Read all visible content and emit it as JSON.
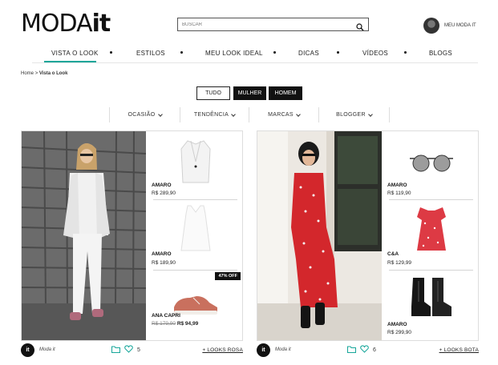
{
  "brand": {
    "logo_main": "MODA",
    "logo_it": "it"
  },
  "search": {
    "placeholder": "BUSCAR"
  },
  "account": {
    "label": "MEU MODA IT"
  },
  "nav": {
    "items": [
      "VISTA O LOOK",
      "ESTILOS",
      "MEU LOOK IDEAL",
      "DICAS",
      "VÍDEOS",
      "BLOGS"
    ],
    "active": "VISTA O LOOK",
    "accent_color": "#17a69a"
  },
  "breadcrumb": {
    "home": "Home",
    "separator": ">",
    "current": "Vista o Look"
  },
  "gender_filter": {
    "all": "TUDO",
    "women": "MULHER",
    "men": "HOMEM"
  },
  "filters": [
    "OCASIÃO",
    "TENDÊNCIA",
    "MARCAS",
    "BLOGGER"
  ],
  "looks": [
    {
      "author": "Moda it",
      "likes": "5",
      "more_link": "+ LOOKS ROSA",
      "items": [
        {
          "brand": "AMARO",
          "price": "R$ 289,90",
          "icon": "white-blazer"
        },
        {
          "brand": "AMARO",
          "price": "R$ 189,90",
          "icon": "white-top"
        },
        {
          "brand": "ANA CAPRI",
          "old_price": "R$ 179,90",
          "price": "R$ 94,99",
          "badge": "47% OFF",
          "icon": "pink-sneaker"
        }
      ]
    },
    {
      "author": "Moda it",
      "likes": "6",
      "more_link": "+ LOOKS BOTA",
      "items": [
        {
          "brand": "AMARO",
          "price": "R$ 119,90",
          "icon": "sunglasses"
        },
        {
          "brand": "C&A",
          "price": "R$ 129,99",
          "icon": "red-floral-dress"
        },
        {
          "brand": "AMARO",
          "price": "R$ 299,90",
          "icon": "black-boots"
        }
      ]
    }
  ]
}
